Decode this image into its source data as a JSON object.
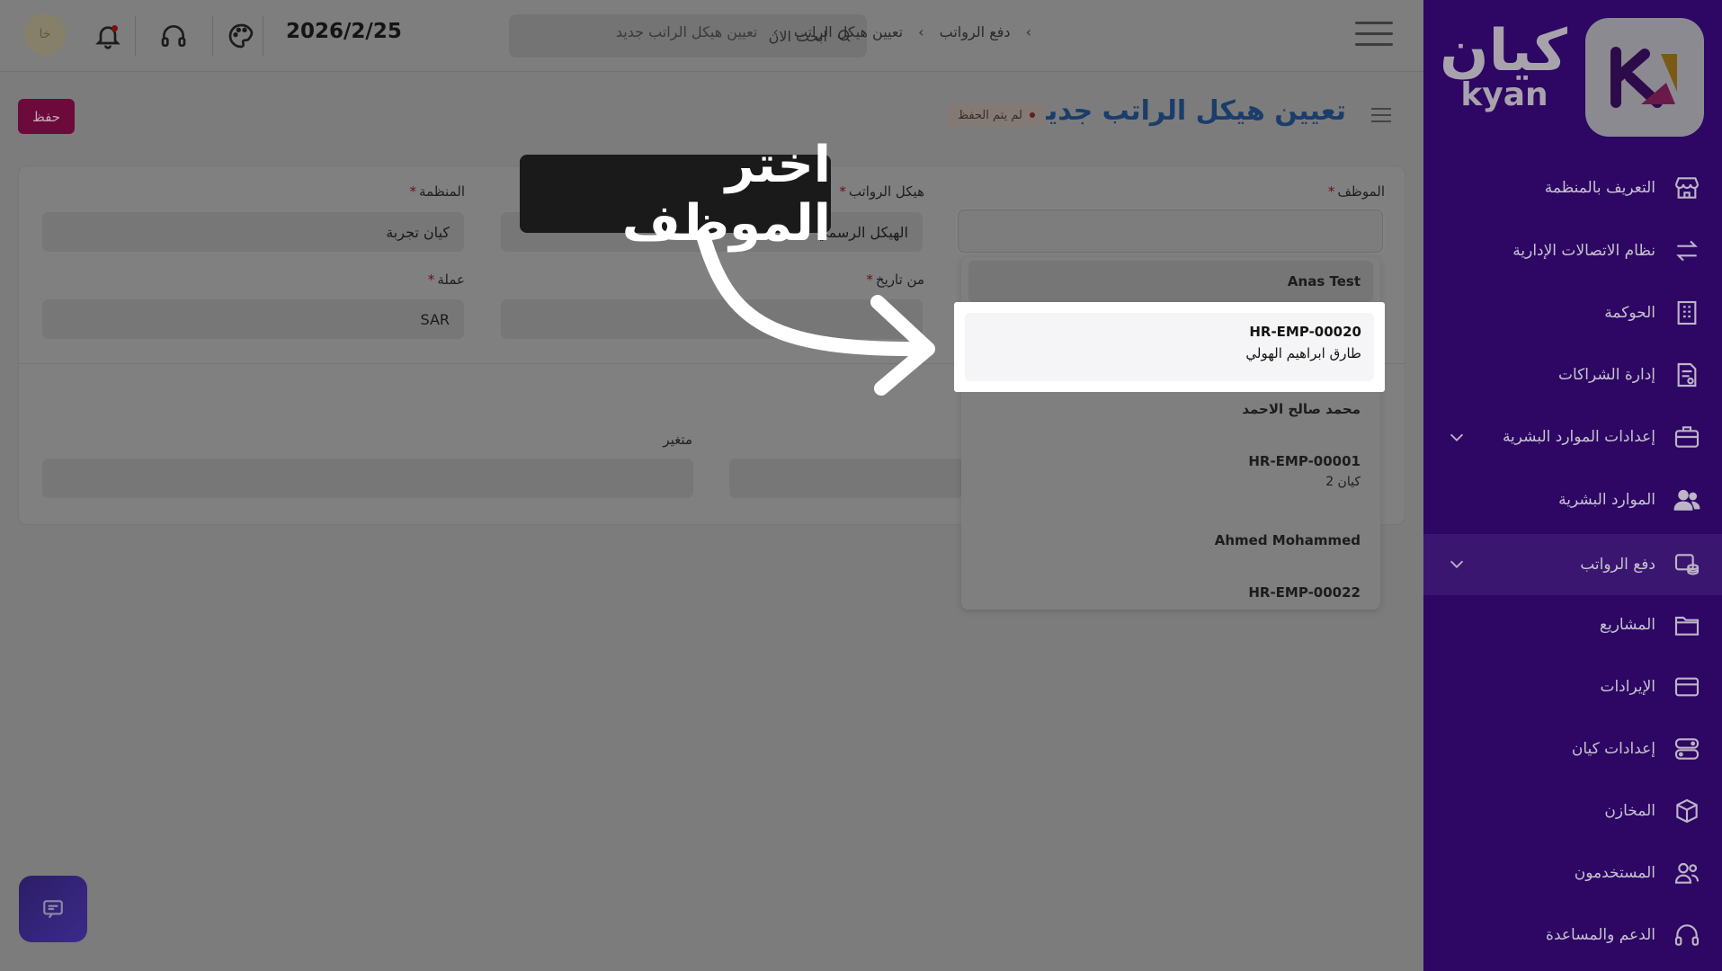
{
  "topbar": {
    "breadcrumbs": [
      "دفع الرواتب",
      "تعيين هيكل الراتب",
      "تعيين هيكل الراتب جديد"
    ],
    "search_placeholder": "ابحث الان",
    "date": "2026/2/25",
    "avatar_initials": "خا"
  },
  "page": {
    "title": "تعيين هيكل الراتب جديد",
    "status_badge": "لم يتم الحفظ",
    "save_label": "حفظ"
  },
  "form": {
    "employee_label": "الموظف",
    "employee_value": "",
    "salary_structure_label": "هيكل الرواتب",
    "salary_structure_value": "الهيكل الرسمي",
    "company_label": "المنظمة",
    "company_value": "كيان تجربة",
    "from_date_label": "من تاريخ",
    "from_date_value": "",
    "currency_label": "عملة",
    "currency_value": "SAR",
    "variable_label": "متغير",
    "variable_value": ""
  },
  "dropdown": {
    "options": [
      {
        "primary": "Anas Test",
        "secondary": ""
      },
      {
        "primary": "HR-EMP-00020",
        "secondary": "طارق ابراهيم الهولي"
      },
      {
        "primary": "محمد صالح الاحمد",
        "secondary": ""
      },
      {
        "primary": "HR-EMP-00001",
        "secondary": "كيان 2"
      },
      {
        "primary": "Ahmed Mohammed",
        "secondary": ""
      },
      {
        "primary": "HR-EMP-00022",
        "secondary": ""
      }
    ]
  },
  "tooltip": {
    "text": "اختر الموظف"
  },
  "sidebar": {
    "logo_ar": "كيان",
    "logo_en": "kyan",
    "items": [
      {
        "label": "التعريف بالمنظمة",
        "icon": "store-icon"
      },
      {
        "label": "نظام الاتصالات الإدارية",
        "icon": "arrows-exchange-icon"
      },
      {
        "label": "الحوكمة",
        "icon": "building-icon"
      },
      {
        "label": "إدارة الشراكات",
        "icon": "document-icon"
      },
      {
        "label": "إعدادات الموارد البشرية",
        "icon": "briefcase-icon"
      },
      {
        "label": "الموارد البشرية",
        "icon": "users-icon"
      },
      {
        "label": "دفع الرواتب",
        "icon": "coins-icon"
      },
      {
        "label": "المشاريع",
        "icon": "folder-icon"
      },
      {
        "label": "الإيرادات",
        "icon": "card-icon"
      },
      {
        "label": "إعدادات كيان",
        "icon": "server-icon"
      },
      {
        "label": "المخازن",
        "icon": "box-icon"
      },
      {
        "label": "المستخدمون",
        "icon": "user-group-icon"
      },
      {
        "label": "الدعم والمساعدة",
        "icon": "headset-icon"
      }
    ]
  },
  "colors": {
    "sidebar_bg": "#2d0763",
    "accent_save": "#6c0a3c",
    "title_color": "#1a3d6a"
  }
}
